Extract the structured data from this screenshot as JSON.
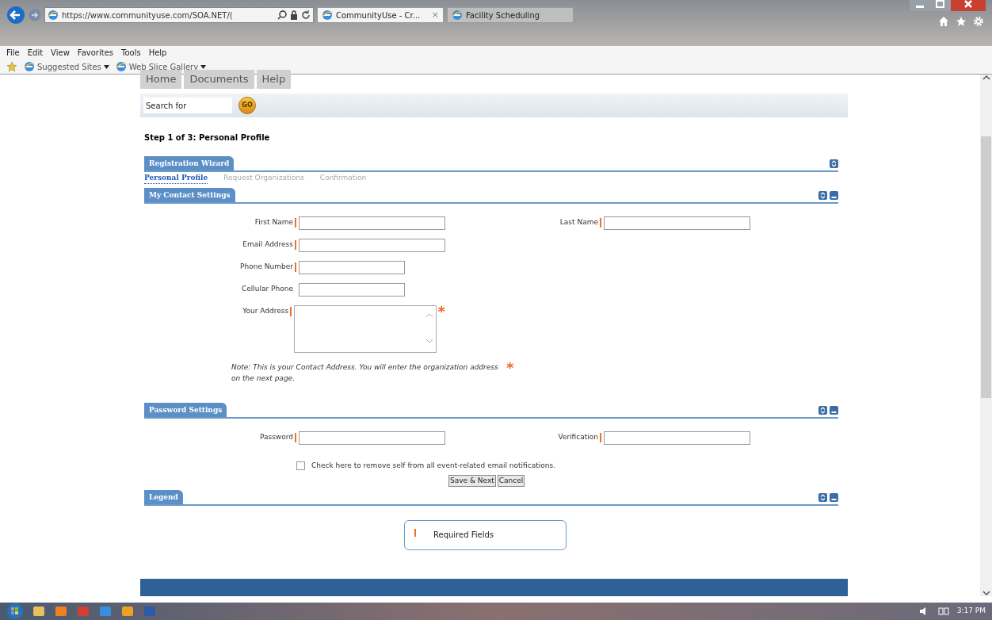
{
  "browser": {
    "address": "https://www.communityuse.com/SOA.NET/(",
    "tabs": [
      {
        "label": "CommunityUse - Cr...",
        "selected": true
      },
      {
        "label": "Facility Scheduling",
        "selected": false
      }
    ],
    "close_glyph": "×",
    "menu": [
      "File",
      "Edit",
      "View",
      "Favorites",
      "Tools",
      "Help"
    ],
    "favorites": [
      "Suggested Sites",
      "Web Slice Gallery"
    ]
  },
  "nav_tabs": [
    "Home",
    "Documents",
    "Help"
  ],
  "search": {
    "placeholder": "Search for",
    "button": "GO"
  },
  "step_title": "Step 1 of 3: Personal Profile",
  "wizard": {
    "title": "Registration Wizard",
    "steps": [
      {
        "label": "Personal Profile",
        "selected": true
      },
      {
        "label": "Request Organizations",
        "selected": false
      },
      {
        "label": "Confirmation",
        "selected": false
      }
    ]
  },
  "contact": {
    "title": "My Contact Settings",
    "rows": [
      [
        {
          "label": "First Name",
          "required": true,
          "kind": "text"
        },
        {
          "label": "Last Name",
          "required": true,
          "kind": "text"
        }
      ],
      [
        {
          "label": "Email Address",
          "required": true,
          "kind": "text"
        }
      ],
      [
        {
          "label": "Phone Number",
          "required": true,
          "kind": "short_text"
        }
      ],
      [
        {
          "label": "Cellular Phone",
          "required": false,
          "kind": "short_text"
        }
      ],
      [
        {
          "label": "Your Address",
          "required": true,
          "kind": "textarea",
          "flag": "*"
        }
      ]
    ],
    "note": "Note: This is your Contact Address. You will enter the organization address on the next page.",
    "note_flag": "*"
  },
  "password": {
    "title": "Password Settings",
    "rows": [
      [
        {
          "label": "Password",
          "required": true,
          "kind": "text"
        },
        {
          "label": "Verification",
          "required": true,
          "kind": "text"
        }
      ]
    ],
    "checkbox": {
      "label": "Check here to remove self from all event-related email notifications.",
      "checked": false
    }
  },
  "buttons": [
    "Save & Next",
    "Cancel"
  ],
  "legend": {
    "title": "Legend",
    "items": [
      {
        "label": "Required Fields"
      }
    ]
  },
  "taskbar": {
    "clock": "3:17 PM"
  }
}
